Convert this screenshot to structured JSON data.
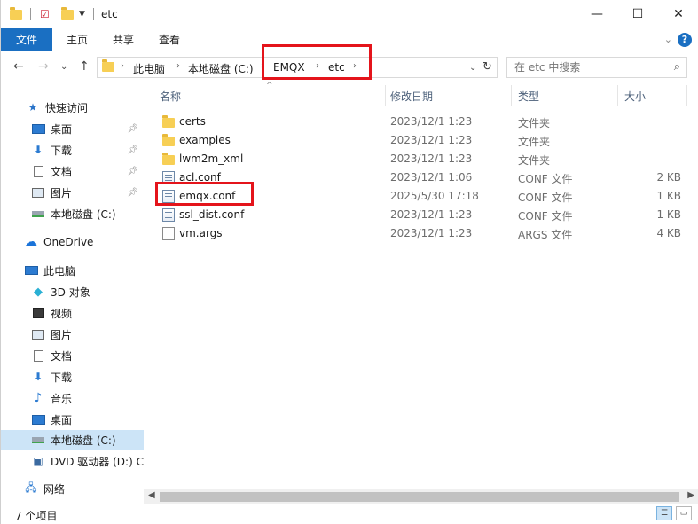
{
  "window": {
    "title": "etc",
    "controls": {
      "minimize": "—",
      "maximize": "☐",
      "close": "✕"
    }
  },
  "ribbon": {
    "tabs": [
      "文件",
      "主页",
      "共享",
      "查看"
    ],
    "help": "?",
    "expand": "⌄"
  },
  "address": {
    "crumbs": [
      "此电脑",
      "本地磁盘 (C:)",
      "EMQX",
      "etc"
    ],
    "search_placeholder": "在 etc 中搜索"
  },
  "navigation": {
    "quick_access_label": "快速访问",
    "quick_access": [
      {
        "label": "桌面",
        "icon": "desktop-icon",
        "pinned": true
      },
      {
        "label": "下载",
        "icon": "download-icon",
        "pinned": true
      },
      {
        "label": "文档",
        "icon": "documents-icon",
        "pinned": true
      },
      {
        "label": "图片",
        "icon": "pictures-icon",
        "pinned": true
      },
      {
        "label": "本地磁盘 (C:)",
        "icon": "drive-icon",
        "pinned": false
      }
    ],
    "onedrive_label": "OneDrive",
    "this_pc_label": "此电脑",
    "this_pc": [
      {
        "label": "3D 对象",
        "icon": "3d-objects-icon"
      },
      {
        "label": "视频",
        "icon": "videos-icon"
      },
      {
        "label": "图片",
        "icon": "pictures-icon"
      },
      {
        "label": "文档",
        "icon": "documents-icon"
      },
      {
        "label": "下载",
        "icon": "download-icon"
      },
      {
        "label": "音乐",
        "icon": "music-icon"
      },
      {
        "label": "桌面",
        "icon": "desktop-icon"
      },
      {
        "label": "本地磁盘 (C:)",
        "icon": "drive-icon"
      },
      {
        "label": "DVD 驱动器 (D:) C",
        "icon": "dvd-icon"
      }
    ],
    "network_label": "网络"
  },
  "columns": {
    "name": "名称",
    "date": "修改日期",
    "type": "类型",
    "size": "大小"
  },
  "files": [
    {
      "name": "certs",
      "date": "2023/12/1 1:23",
      "type": "文件夹",
      "size": "",
      "kind": "folder"
    },
    {
      "name": "examples",
      "date": "2023/12/1 1:23",
      "type": "文件夹",
      "size": "",
      "kind": "folder"
    },
    {
      "name": "lwm2m_xml",
      "date": "2023/12/1 1:23",
      "type": "文件夹",
      "size": "",
      "kind": "folder"
    },
    {
      "name": "acl.conf",
      "date": "2023/12/1 1:06",
      "type": "CONF 文件",
      "size": "2 KB",
      "kind": "conf"
    },
    {
      "name": "emqx.conf",
      "date": "2025/5/30 17:18",
      "type": "CONF 文件",
      "size": "1 KB",
      "kind": "conf"
    },
    {
      "name": "ssl_dist.conf",
      "date": "2023/12/1 1:23",
      "type": "CONF 文件",
      "size": "1 KB",
      "kind": "conf"
    },
    {
      "name": "vm.args",
      "date": "2023/12/1 1:23",
      "type": "ARGS 文件",
      "size": "4 KB",
      "kind": "doc"
    }
  ],
  "status": {
    "item_count": "7 个项目"
  },
  "colors": {
    "accent": "#1a6fc2",
    "highlight": "#e4141b",
    "selection": "#cce4f7"
  }
}
